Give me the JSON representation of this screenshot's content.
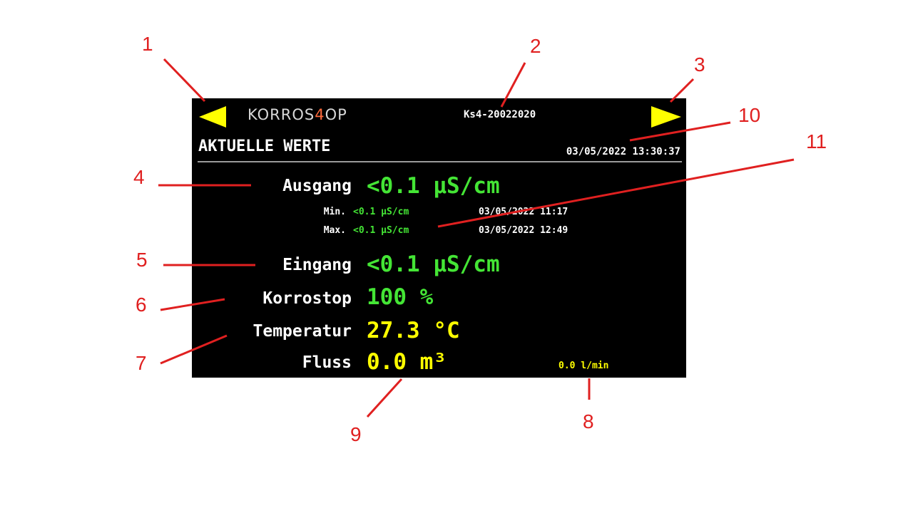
{
  "header": {
    "logo_main": "KORROS",
    "logo_accent": "4",
    "logo_end": "OP",
    "device_id": "Ks4-20022020",
    "page_title": "AKTUELLE WERTE",
    "datetime": "03/05/2022 13:30:37"
  },
  "nav": {
    "prev_icon": "triangle-left-icon",
    "next_icon": "triangle-right-icon"
  },
  "readings": {
    "ausgang": {
      "label": "Ausgang",
      "value": "<0.1 μS/cm"
    },
    "ausgang_min": {
      "label": "Min.",
      "value": "<0.1 μS/cm",
      "datetime": "03/05/2022 11:17"
    },
    "ausgang_max": {
      "label": "Max.",
      "value": "<0.1 μS/cm",
      "datetime": "03/05/2022 12:49"
    },
    "eingang": {
      "label": "Eingang",
      "value": "<0.1 μS/cm"
    },
    "korrostop": {
      "label": "Korrostop",
      "value": "100 %"
    },
    "temperatur": {
      "label": "Temperatur",
      "value": "27.3 °C"
    },
    "fluss": {
      "label": "Fluss",
      "value": "0.0 m³",
      "rate": "0.0 l/min"
    }
  },
  "callouts": [
    "1",
    "2",
    "3",
    "4",
    "5",
    "6",
    "7",
    "8",
    "9",
    "10",
    "11"
  ],
  "colors": {
    "screen_bg": "#000000",
    "value_green": "#44e535",
    "value_yellow": "#ffff00",
    "callout_red": "#e02020"
  }
}
